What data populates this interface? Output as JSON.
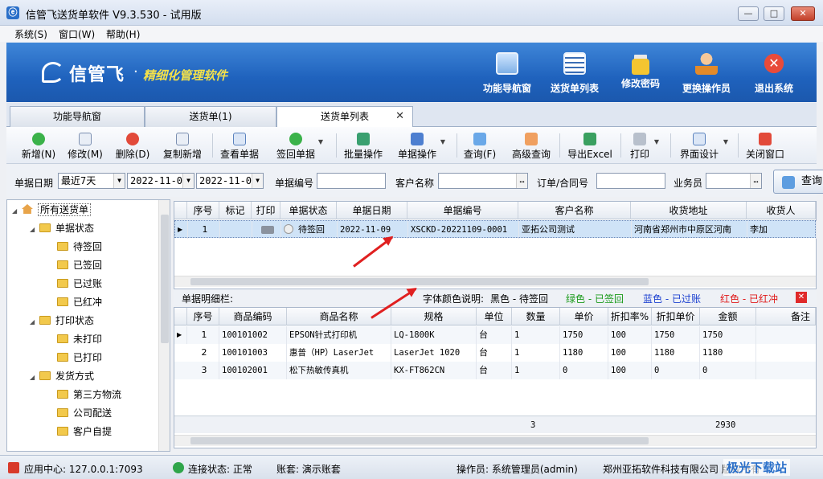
{
  "window": {
    "title": "信管飞送货单软件 V9.3.530 - 试用版",
    "min": "—",
    "max": "□",
    "close": "✕"
  },
  "menu": [
    "系统(S)",
    "窗口(W)",
    "帮助(H)"
  ],
  "banner": {
    "logo": "信管飞",
    "dot": "·",
    "slogan": "精细化管理软件",
    "buttons": [
      "功能导航窗",
      "送货单列表",
      "修改密码",
      "更换操作员",
      "退出系统"
    ]
  },
  "tabs": [
    "功能导航窗",
    "送货单(1)",
    "送货单列表"
  ],
  "tab_close": "✕",
  "toolbar": [
    "新增(N)",
    "修改(M)",
    "删除(D)",
    "复制新增",
    "查看单据",
    "签回单据",
    "批量操作",
    "单据操作",
    "查询(F)",
    "高级查询",
    "导出Excel",
    "打印",
    "界面设计",
    "关闭窗口"
  ],
  "filter": {
    "date_label": "单据日期",
    "date_range": "最近7天",
    "date_from": "2022-11-02",
    "date_to": "2022-11-09",
    "no_label": "单据编号",
    "customer_label": "客户名称",
    "order_label": "订单/合同号",
    "salesman_label": "业务员",
    "query": "查询"
  },
  "tree": {
    "root": "所有送货单",
    "groups": [
      {
        "label": "单据状态",
        "items": [
          "待签回",
          "已签回",
          "已过账",
          "已红冲"
        ]
      },
      {
        "label": "打印状态",
        "items": [
          "未打印",
          "已打印"
        ]
      },
      {
        "label": "发货方式",
        "items": [
          "第三方物流",
          "公司配送",
          "客户自提"
        ]
      }
    ]
  },
  "list_grid": {
    "headers": [
      "序号",
      "标记",
      "打印",
      "单据状态",
      "单据日期",
      "单据编号",
      "客户名称",
      "收货地址",
      "收货人"
    ],
    "rows": [
      {
        "seq": "1",
        "mark": "",
        "status": "待签回",
        "date": "2022-11-09",
        "no": "XSCKD-20221109-0001",
        "customer": "亚拓公司测试",
        "address": "河南省郑州市中原区河南",
        "receiver": "李加"
      }
    ]
  },
  "detail": {
    "label": "单据明细栏:",
    "legend_title": "字体颜色说明:",
    "legend": [
      {
        "text": "黑色 - 待签回",
        "color": "#000000"
      },
      {
        "text": "绿色 - 已签回",
        "color": "#1a9a1a"
      },
      {
        "text": "蓝色 - 已过账",
        "color": "#1a3fd0"
      },
      {
        "text": "红色 - 已红冲",
        "color": "#e01818"
      }
    ],
    "headers": [
      "序号",
      "商品编码",
      "商品名称",
      "规格",
      "单位",
      "数量",
      "单价",
      "折扣率%",
      "折扣单价",
      "金额",
      "备注"
    ],
    "rows": [
      {
        "seq": "1",
        "code": "100101002",
        "name": "EPSON针式打印机",
        "spec": "LQ-1800K",
        "unit": "台",
        "qty": "1",
        "price": "1750",
        "rate": "100",
        "dprice": "1750",
        "amount": "1750"
      },
      {
        "seq": "2",
        "code": "100101003",
        "name": "惠普（HP）LaserJet",
        "spec": "LaserJet 1020",
        "unit": "台",
        "qty": "1",
        "price": "1180",
        "rate": "100",
        "dprice": "1180",
        "amount": "1180"
      },
      {
        "seq": "3",
        "code": "100102001",
        "name": "松下热敏传真机",
        "spec": "KX-FT862CN",
        "unit": "台",
        "qty": "1",
        "price": "0",
        "rate": "100",
        "dprice": "0",
        "amount": "0"
      }
    ],
    "total_qty": "3",
    "total_amount": "2930"
  },
  "status": {
    "app_center": "应用中心: 127.0.0.1:7093",
    "conn": "连接状态: 正常",
    "account": "账套: 演示账套",
    "operator": "操作员: 系统管理员(admin)",
    "company": "郑州亚拓软件科技有限公司 版权所有"
  },
  "watermark": "极光下载站"
}
